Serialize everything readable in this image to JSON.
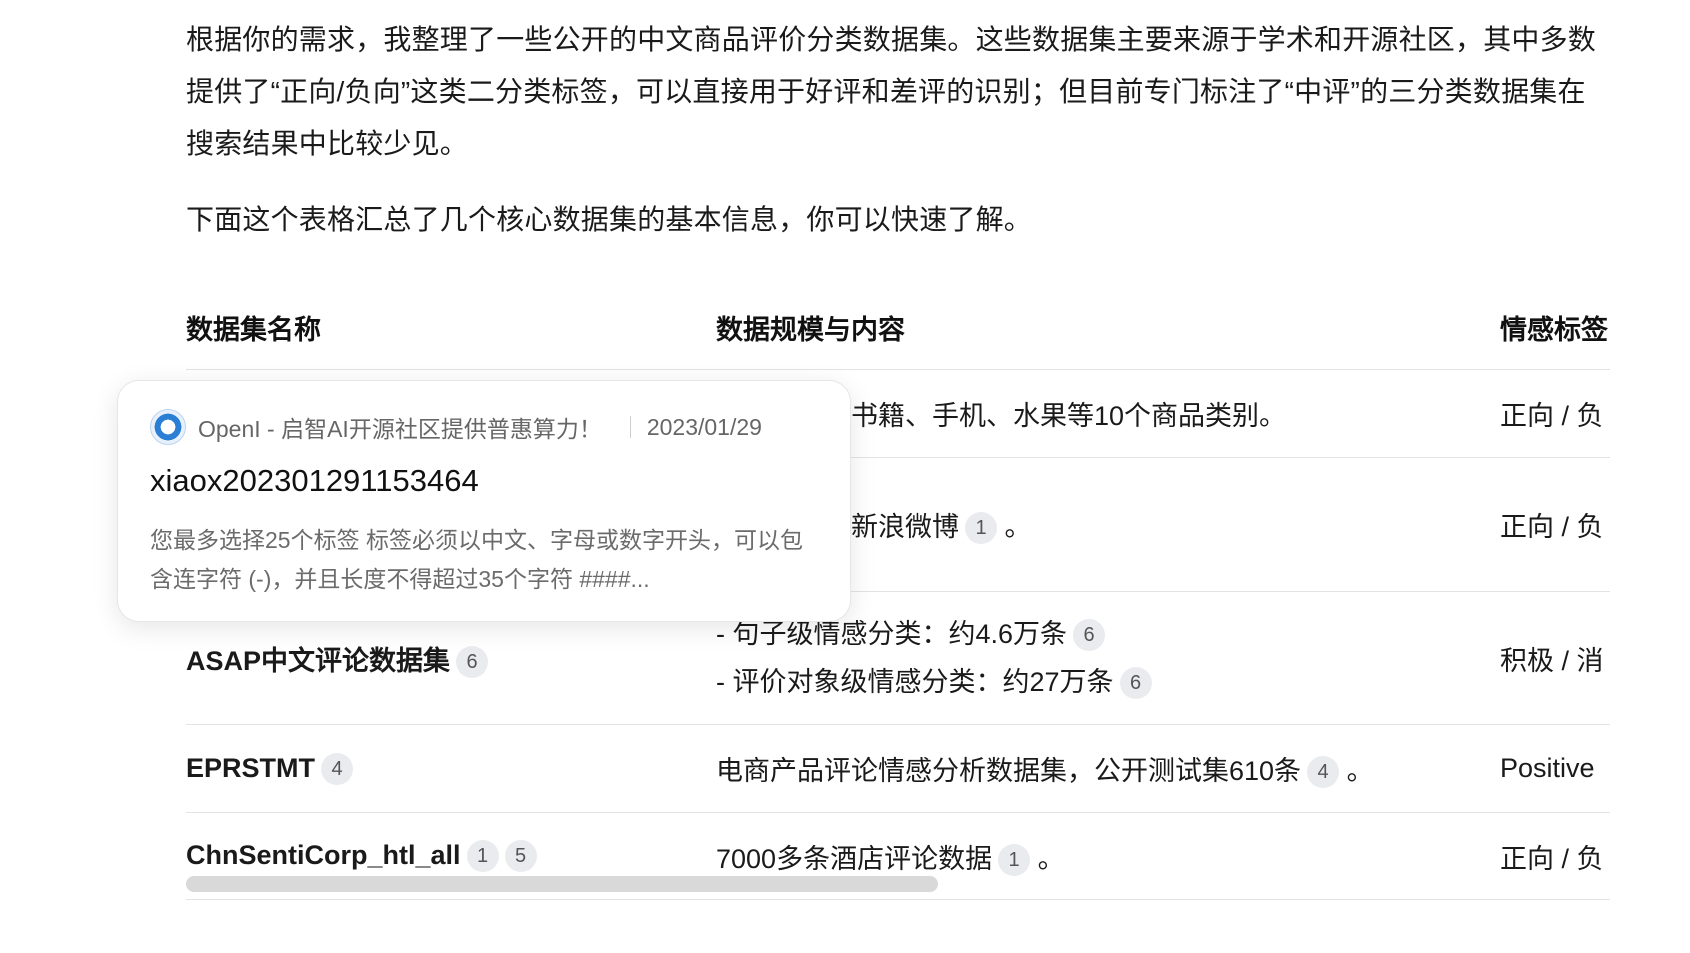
{
  "intro": {
    "paragraph1": "根据你的需求，我整理了一些公开的中文商品评价分类数据集。这些数据集主要来源于学术和开源社区，其中多数提供了“正向/负向”这类二分类标签，可以直接用于好评和差评的识别；但目前专门标注了“中评”的三分类数据集在搜索结果中比较少见。",
    "paragraph2": "下面这个表格汇总了几个核心数据集的基本信息，你可以快速了解。"
  },
  "table": {
    "headers": [
      "数据集名称",
      "数据规模与内容",
      "情感标签"
    ],
    "rows": [
      {
        "name": "",
        "content": "评论，覆盖书籍、手机、水果等10个商品类别。",
        "label": "正向 / 负"
      },
      {
        "name": "",
        "content": "情感标注的新浪微博",
        "content_badge": "1",
        "content_suffix": "。",
        "label": "正向 / 负"
      },
      {
        "name": "ASAP中文评论数据集",
        "name_badge": "6",
        "content_line1": "- 句子级情感分类：约4.6万条",
        "content_line1_badge": "6",
        "content_line2": "- 评价对象级情感分类：约27万条",
        "content_line2_badge": "6",
        "label": "积极 / 消"
      },
      {
        "name": "EPRSTMT",
        "name_badge": "4",
        "content": "电商产品评论情感分析数据集，公开测试集610条",
        "content_badge": "4",
        "content_suffix": "。",
        "label": "Positive"
      },
      {
        "name": "ChnSentiCorp_htl_all",
        "name_badge": "1",
        "name_badge2": "5",
        "content": "7000多条酒店评论数据",
        "content_badge": "1",
        "content_suffix": "。",
        "label": "正向 / 负"
      }
    ]
  },
  "popover": {
    "site": "OpenI - 启智AI开源社区提供普惠算力！",
    "date": "2023/01/29",
    "title": "xiaox202301291153464",
    "snippet": "您最多选择25个标签 标签必须以中文、字母或数字开头，可以包含连字符 (-)，并且长度不得超过35个字符 ####...",
    "icon": "openi-logo-icon"
  }
}
